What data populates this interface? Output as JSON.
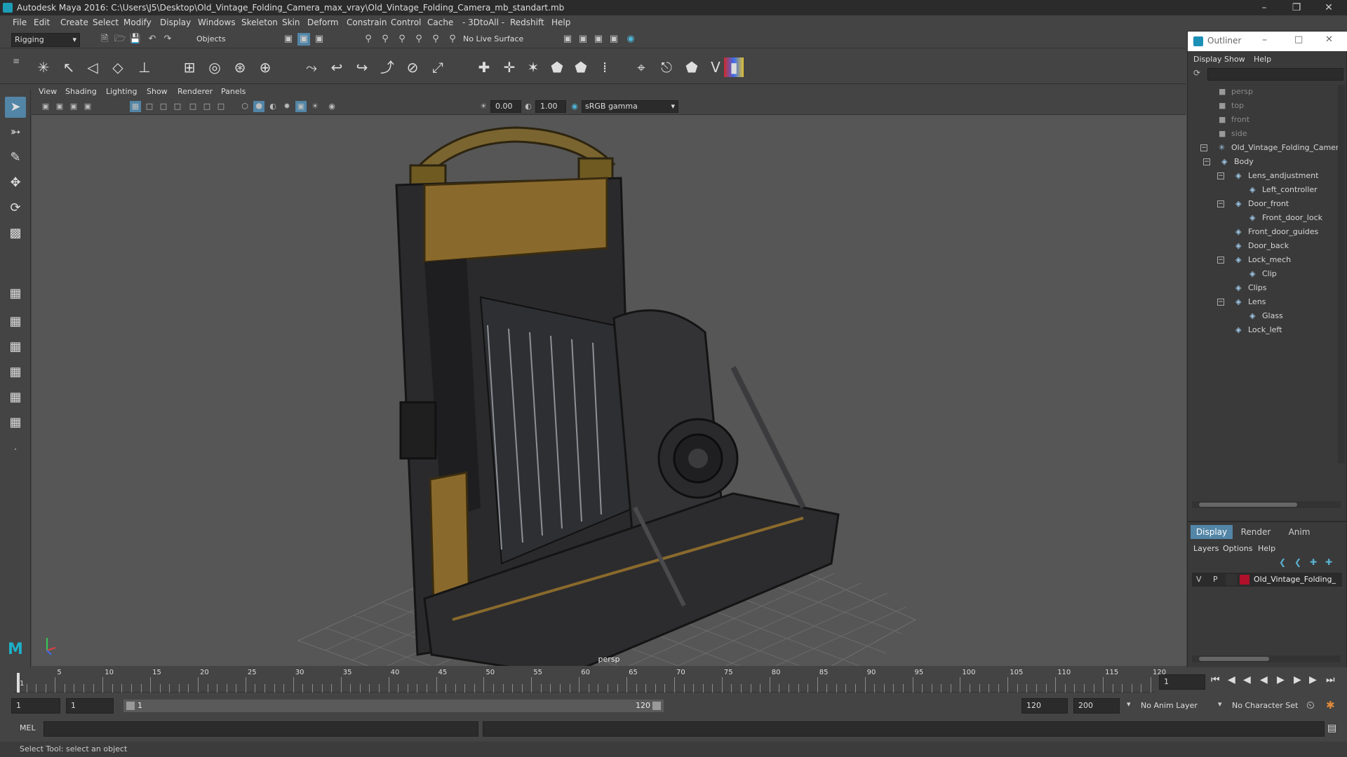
{
  "window": {
    "title": "Autodesk Maya 2016: C:\\Users\\J5\\Desktop\\Old_Vintage_Folding_Camera_max_vray\\Old_Vintage_Folding_Camera_mb_standart.mb"
  },
  "menubar": [
    "File",
    "Edit",
    "Create",
    "Select",
    "Modify",
    "Display",
    "Windows",
    "Skeleton",
    "Skin",
    "Deform",
    "Constrain",
    "Control",
    "Cache",
    "- 3DtoAll -",
    "Redshift",
    "Help"
  ],
  "statusline": {
    "mode": "Rigging",
    "selection": "Objects",
    "live_surface": "No Live Surface"
  },
  "viewport": {
    "menu": [
      "View",
      "Shading",
      "Lighting",
      "Show",
      "Renderer",
      "Panels"
    ],
    "exposure": "0.00",
    "gamma": "1.00",
    "color_space": "sRGB gamma",
    "camera_label": "persp"
  },
  "outliner": {
    "title": "Outliner",
    "menu": [
      "Display",
      "Show",
      "Help"
    ],
    "items": [
      {
        "label": "persp",
        "depth": 0,
        "dim": true
      },
      {
        "label": "top",
        "depth": 0,
        "dim": true
      },
      {
        "label": "front",
        "depth": 0,
        "dim": true
      },
      {
        "label": "side",
        "depth": 0,
        "dim": true
      },
      {
        "label": "Old_Vintage_Folding_Camer",
        "depth": 0,
        "dim": false
      },
      {
        "label": "Body",
        "depth": 1,
        "dim": false
      },
      {
        "label": "Lens_andjustment",
        "depth": 2,
        "dim": false
      },
      {
        "label": "Left_controller",
        "depth": 3,
        "dim": false
      },
      {
        "label": "Door_front",
        "depth": 2,
        "dim": false
      },
      {
        "label": "Front_door_lock",
        "depth": 3,
        "dim": false
      },
      {
        "label": "Front_door_guides",
        "depth": 2,
        "dim": false
      },
      {
        "label": "Door_back",
        "depth": 2,
        "dim": false
      },
      {
        "label": "Lock_mech",
        "depth": 2,
        "dim": false
      },
      {
        "label": "Clip",
        "depth": 3,
        "dim": false
      },
      {
        "label": "Clips",
        "depth": 2,
        "dim": false
      },
      {
        "label": "Lens",
        "depth": 2,
        "dim": false
      },
      {
        "label": "Glass",
        "depth": 3,
        "dim": false
      },
      {
        "label": "Lock_left",
        "depth": 2,
        "dim": false
      }
    ]
  },
  "layers": {
    "tabs": [
      "Display",
      "Render",
      "Anim"
    ],
    "menu": [
      "Layers",
      "Options",
      "Help"
    ],
    "row": {
      "v": "V",
      "p": "P",
      "name": "Old_Vintage_Folding_",
      "color": "#b0102a"
    }
  },
  "timeline": {
    "ticks": [
      "5",
      "10",
      "15",
      "20",
      "25",
      "30",
      "35",
      "40",
      "45",
      "50",
      "55",
      "60",
      "65",
      "70",
      "75",
      "80",
      "85",
      "90",
      "95",
      "100",
      "105",
      "110",
      "115",
      "120"
    ],
    "start_tick": "1",
    "current_frame": "1"
  },
  "range": {
    "start": "1",
    "start2": "1",
    "range_start": "1",
    "range_end": "120",
    "end": "120",
    "end2": "200",
    "anim_layer": "No Anim Layer",
    "char_set": "No Character Set"
  },
  "cmd": {
    "label": "MEL"
  },
  "help": {
    "text": "Select Tool: select an object"
  },
  "colors": {
    "accent": "#5285a6",
    "outliner_title": "#1b8fb5"
  }
}
